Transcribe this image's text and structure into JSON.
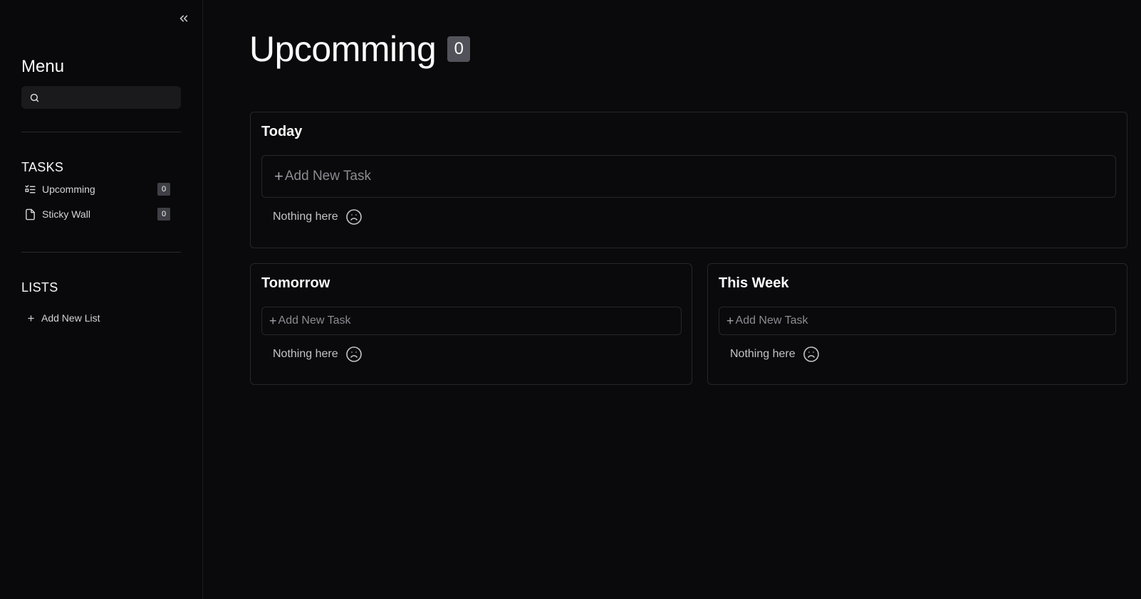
{
  "sidebar": {
    "title": "Menu",
    "search": {
      "value": "",
      "placeholder": ""
    },
    "tasks_section": "TASKS",
    "task_items": [
      {
        "label": "Upcomming",
        "count": "0",
        "icon": "list-checks-icon"
      },
      {
        "label": "Sticky Wall",
        "count": "0",
        "icon": "sticky-note-icon"
      }
    ],
    "lists_section": "LISTS",
    "add_list_label": "Add New List"
  },
  "main": {
    "title": "Upcomming",
    "count": "0",
    "sections": [
      {
        "title": "Today",
        "add_label": "Add New Task",
        "empty_label": "Nothing here"
      },
      {
        "title": "Tomorrow",
        "add_label": "Add New Task",
        "empty_label": "Nothing here"
      },
      {
        "title": "This Week",
        "add_label": "Add New Task",
        "empty_label": "Nothing here"
      }
    ]
  },
  "colors": {
    "background": "#0a0a0c",
    "border": "#27272a",
    "badge": "#52525b"
  }
}
